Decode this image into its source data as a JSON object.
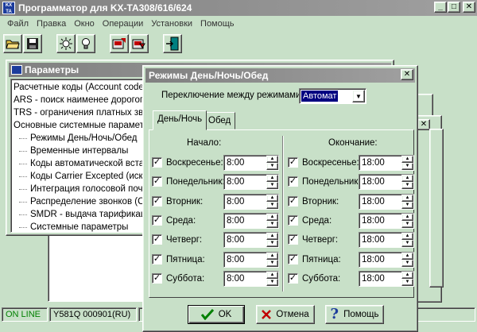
{
  "app": {
    "title": "Программатор для KX-TA308/616/624",
    "icon_text": "KX TA"
  },
  "window_buttons": {
    "minimize": "_",
    "maximize": "□",
    "close": "✕"
  },
  "menu": [
    "Файл",
    "Правка",
    "Окно",
    "Операции",
    "Установки",
    "Помощь"
  ],
  "toolbar": [
    {
      "name": "open-folder-button",
      "icon": "folder-icon"
    },
    {
      "name": "save-button",
      "icon": "floppy-disk-icon"
    },
    {
      "name": "idea-button",
      "icon": "sun-icon"
    },
    {
      "name": "lightbulb-button",
      "icon": "lightbulb-icon"
    },
    {
      "name": "read-pbx-button",
      "icon": "upload-icon"
    },
    {
      "name": "write-pbx-button",
      "icon": "download-icon"
    },
    {
      "name": "exit-button",
      "icon": "exit-door-icon"
    }
  ],
  "params": {
    "title": "Параметры",
    "items": [
      "Расчетные коды (Account codes)",
      "ARS - поиск наименее дорогого п",
      "TRS - ограничения платных звон",
      "Основные системные параметры"
    ],
    "children": [
      "Режимы День/Ночь/Обед",
      "Временные интервалы",
      "Коды автоматической вставк",
      "Коды Carrier Excepted (исключ",
      "Интеграция голосовой почты",
      "Распределение звонков (Call",
      "SMDR - выдача тарификацио",
      "Системные параметры"
    ]
  },
  "status": [
    "ON LINE",
    "Y581Q 000901(RU)"
  ],
  "dialog": {
    "title": "Режимы День/Ночь/Обед",
    "close_label": "✕",
    "mode_label": "Переключение между режимами:",
    "mode_value": "Автомат",
    "tabs": [
      "День/Ночь",
      "Обед"
    ],
    "start_header": "Начало:",
    "end_header": "Окончание:",
    "days": [
      {
        "label": "Воскресенье:",
        "start": "8:00",
        "end": "18:00"
      },
      {
        "label": "Понедельник:",
        "start": "8:00",
        "end": "18:00"
      },
      {
        "label": "Вторник:",
        "start": "8:00",
        "end": "18:00"
      },
      {
        "label": "Среда:",
        "start": "8:00",
        "end": "18:00"
      },
      {
        "label": "Четверг:",
        "start": "8:00",
        "end": "18:00"
      },
      {
        "label": "Пятница:",
        "start": "8:00",
        "end": "18:00"
      },
      {
        "label": "Суббота:",
        "start": "8:00",
        "end": "18:00"
      }
    ],
    "ok_label": "OK",
    "cancel_label": "Отмена",
    "help_label": "Помощь"
  }
}
